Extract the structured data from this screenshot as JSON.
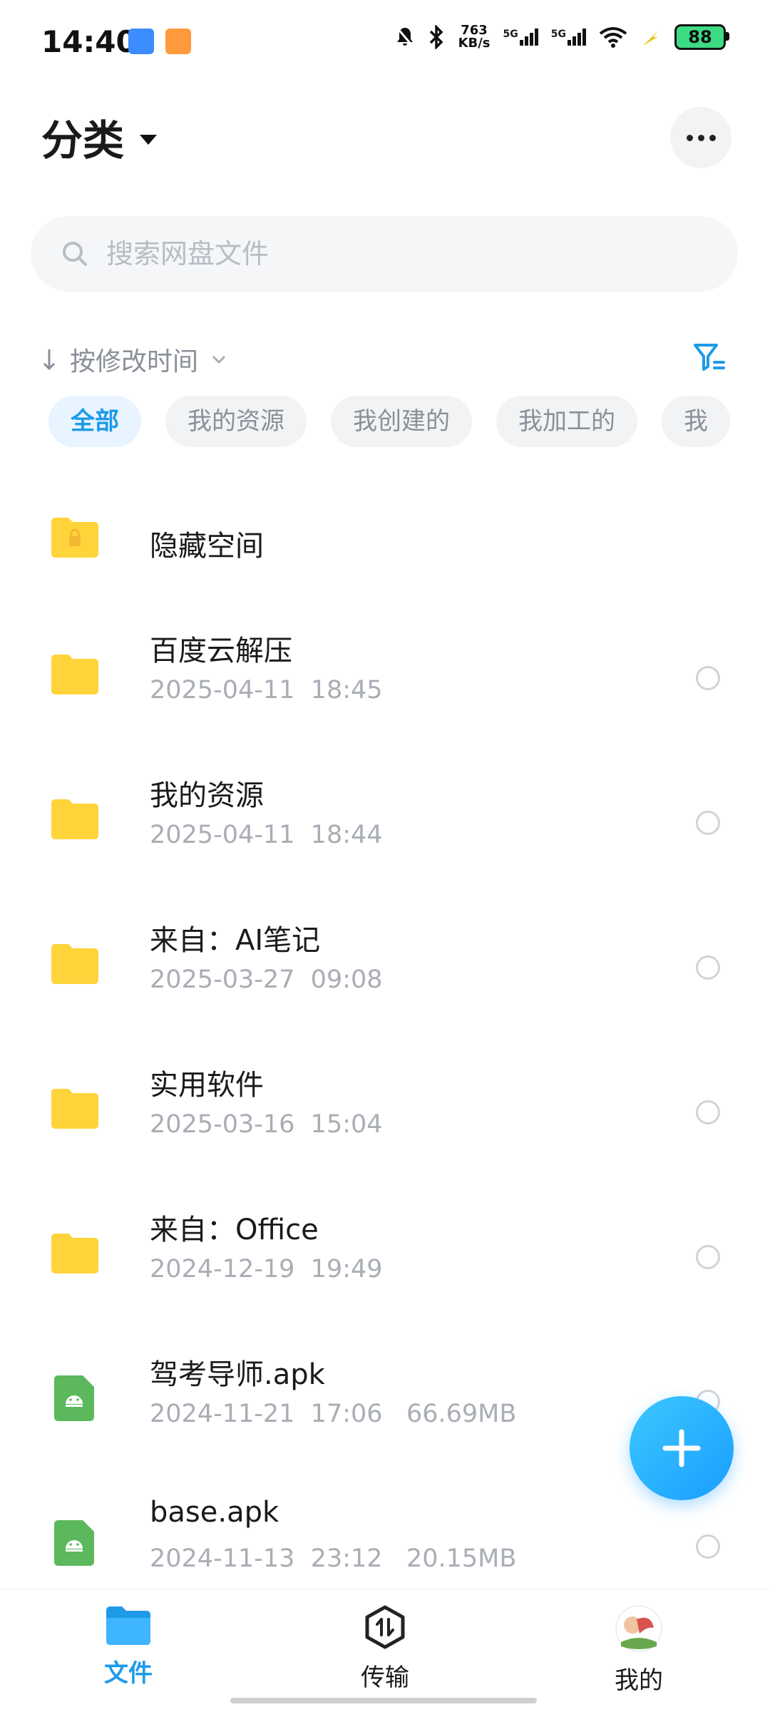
{
  "status_bar": {
    "time": "14:40",
    "net_speed_value": "763",
    "net_speed_unit": "KB/s",
    "sim1": "5G",
    "sim2": "5G",
    "battery": "88",
    "icons": [
      "app-icon",
      "app-icon",
      "alarm-off-icon",
      "bluetooth-icon",
      "signal-icon",
      "signal-icon",
      "wifi-icon",
      "charging-icon",
      "battery-icon"
    ]
  },
  "header": {
    "title": "分类",
    "more_icon": "more-icon"
  },
  "search": {
    "placeholder": "搜索网盘文件"
  },
  "sort": {
    "label": "按修改时间"
  },
  "chips": [
    {
      "label": "全部",
      "active": true
    },
    {
      "label": "我的资源",
      "active": false
    },
    {
      "label": "我创建的",
      "active": false
    },
    {
      "label": "我加工的",
      "active": false
    },
    {
      "label": "我",
      "active": false
    }
  ],
  "files": [
    {
      "name": "隐藏空间",
      "date": "",
      "time": "",
      "size": "",
      "type": "locked-folder"
    },
    {
      "name": "百度云解压",
      "date": "2025-04-11",
      "time": "18:45",
      "size": "",
      "type": "folder"
    },
    {
      "name": "我的资源",
      "date": "2025-04-11",
      "time": "18:44",
      "size": "",
      "type": "folder"
    },
    {
      "name": "来自：AI笔记",
      "date": "2025-03-27",
      "time": "09:08",
      "size": "",
      "type": "folder"
    },
    {
      "name": "实用软件",
      "date": "2025-03-16",
      "time": "15:04",
      "size": "",
      "type": "folder"
    },
    {
      "name": "来自：Office",
      "date": "2024-12-19",
      "time": "19:49",
      "size": "",
      "type": "folder"
    },
    {
      "name": "驾考导师.apk",
      "date": "2024-11-21",
      "time": "17:06",
      "size": "66.69MB",
      "type": "apk"
    },
    {
      "name": "base.apk",
      "date": "2024-11-13",
      "time": "23:12",
      "size": "20.15MB",
      "type": "apk"
    }
  ],
  "nav": {
    "files": "文件",
    "transfer": "传输",
    "mine": "我的"
  },
  "colors": {
    "accent": "#1e9be8",
    "folder": "#ffd43b",
    "apk": "#5cb85c"
  }
}
